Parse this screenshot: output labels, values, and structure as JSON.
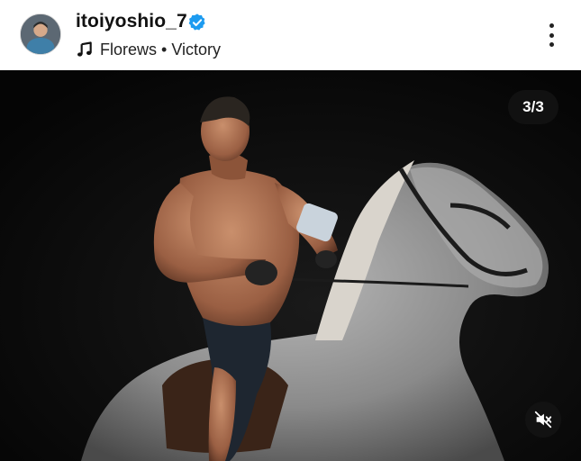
{
  "post": {
    "username": "itoiyoshio_7",
    "verified": true,
    "music": {
      "icon": "music-note-icon",
      "text": "Florews • Victory"
    },
    "more_icon": "more-vertical-icon"
  },
  "media": {
    "counter": "3/3",
    "mute_icon": "speaker-muted-icon",
    "description_icon": "photo-muscular-rider-on-grey-horse"
  },
  "colors": {
    "verified_blue": "#1d9bf0",
    "background": "#000000",
    "overlay": "#141414"
  }
}
